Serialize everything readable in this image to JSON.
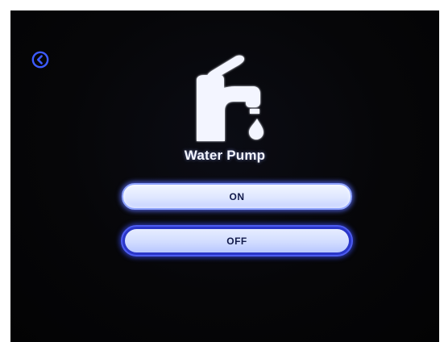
{
  "screen": {
    "title": "Water Pump",
    "icon": "faucet-icon",
    "back_icon": "chevron-left-circle-icon"
  },
  "buttons": {
    "on_label": "ON",
    "off_label": "OFF",
    "selected": "OFF"
  },
  "colors": {
    "accent": "#3b4bff",
    "button_fill": "#dfe7ff",
    "background": "#050507",
    "text": "#f4f6ff"
  }
}
